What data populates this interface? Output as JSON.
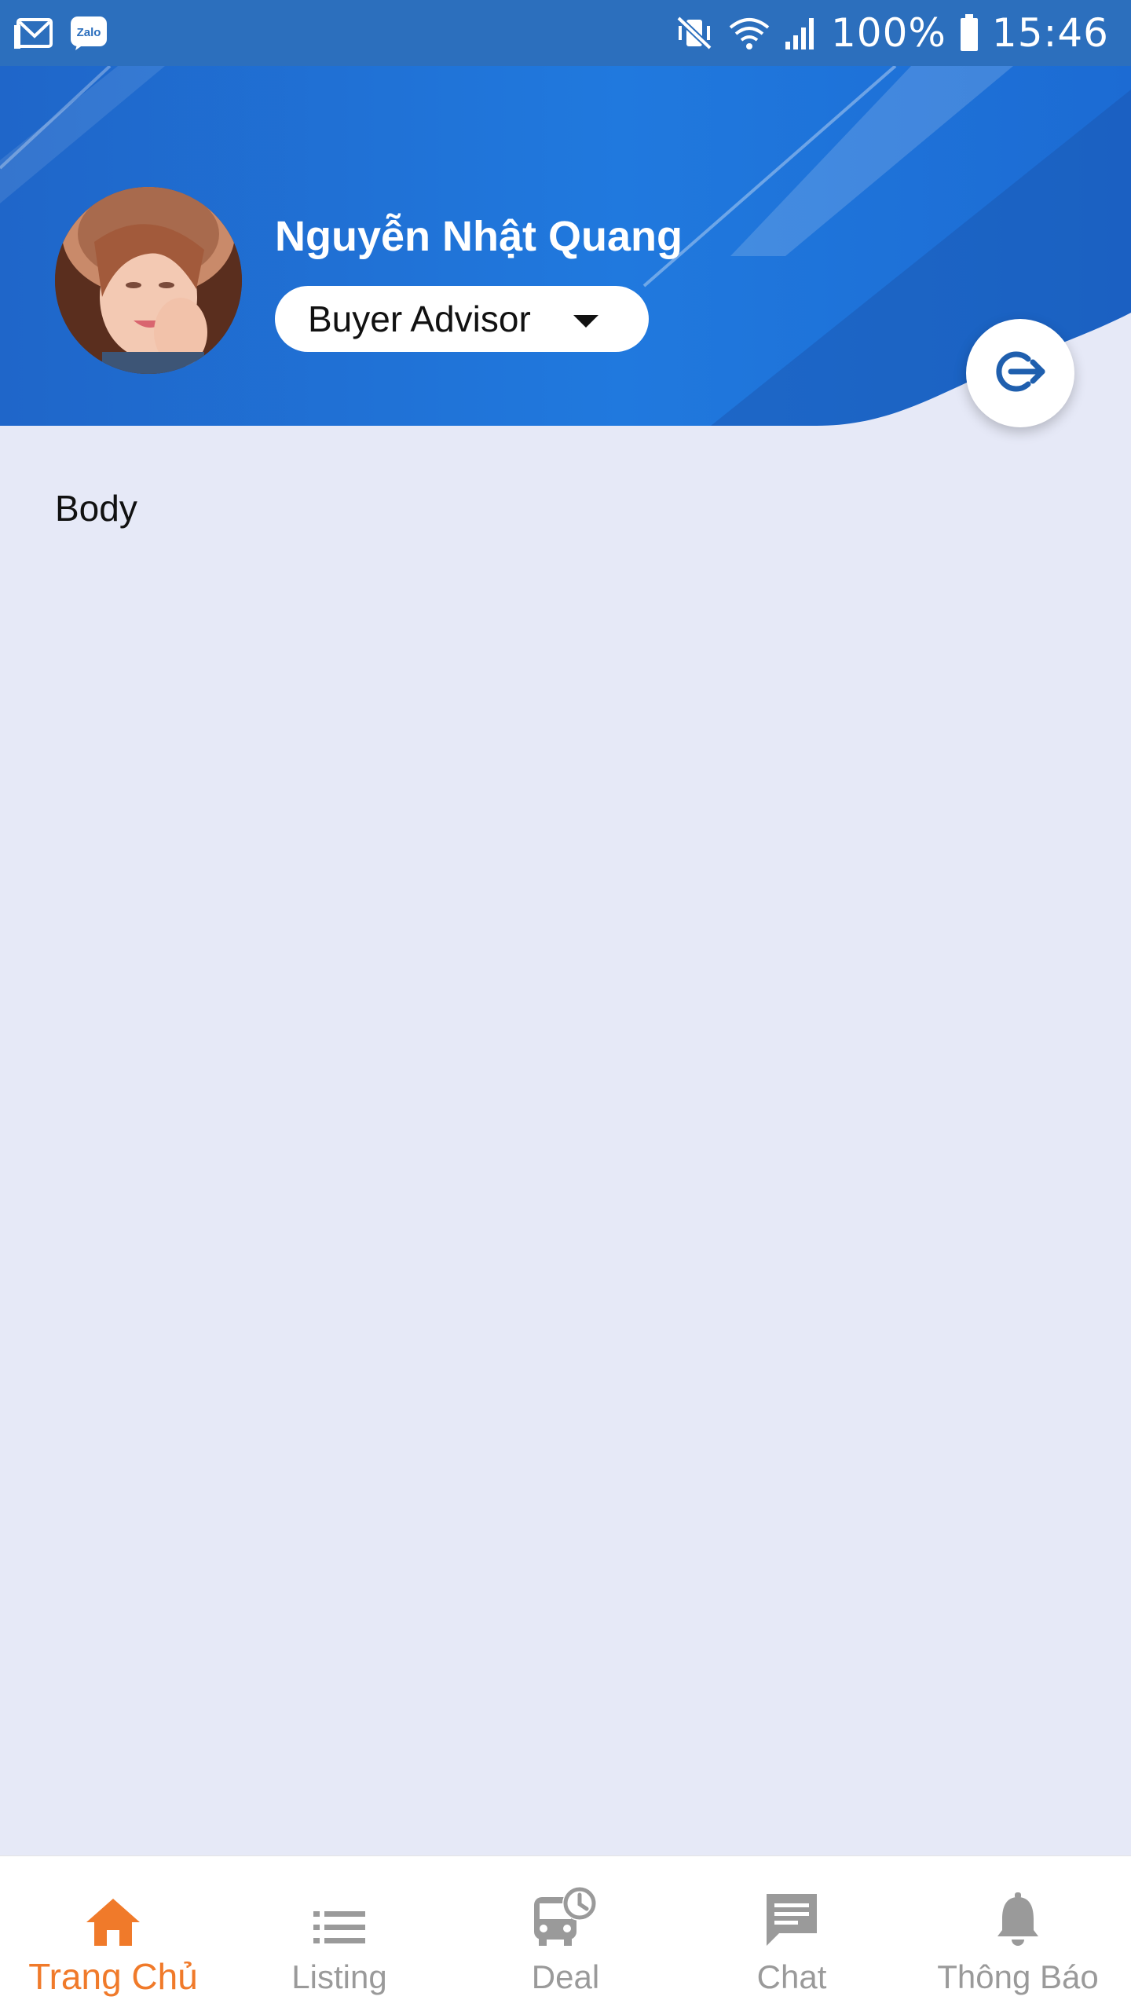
{
  "status_bar": {
    "battery": "100%",
    "time": "15:46",
    "icons": [
      "gmail-icon",
      "zalo-icon",
      "mute-vibrate-icon",
      "wifi-icon",
      "signal-icon",
      "battery-icon"
    ]
  },
  "profile": {
    "name": "Nguyễn Nhật Quang",
    "role": "Buyer Advisor"
  },
  "main": {
    "body_text": "Body"
  },
  "bottom_nav": {
    "items": [
      {
        "label": "Trang Chủ",
        "icon": "home-icon",
        "active": true
      },
      {
        "label": "Listing",
        "icon": "list-icon",
        "active": false
      },
      {
        "label": "Deal",
        "icon": "bus-clock-icon",
        "active": false
      },
      {
        "label": "Chat",
        "icon": "chat-icon",
        "active": false
      },
      {
        "label": "Thông Báo",
        "icon": "bell-icon",
        "active": false
      }
    ]
  },
  "colors": {
    "status_bar": "#2c6fbd",
    "header": "#1f6fd6",
    "background": "#e6e9f7",
    "active_tab": "#f07a2a",
    "inactive_tab": "#9a9a9a",
    "logout_icon": "#1f5fae"
  }
}
